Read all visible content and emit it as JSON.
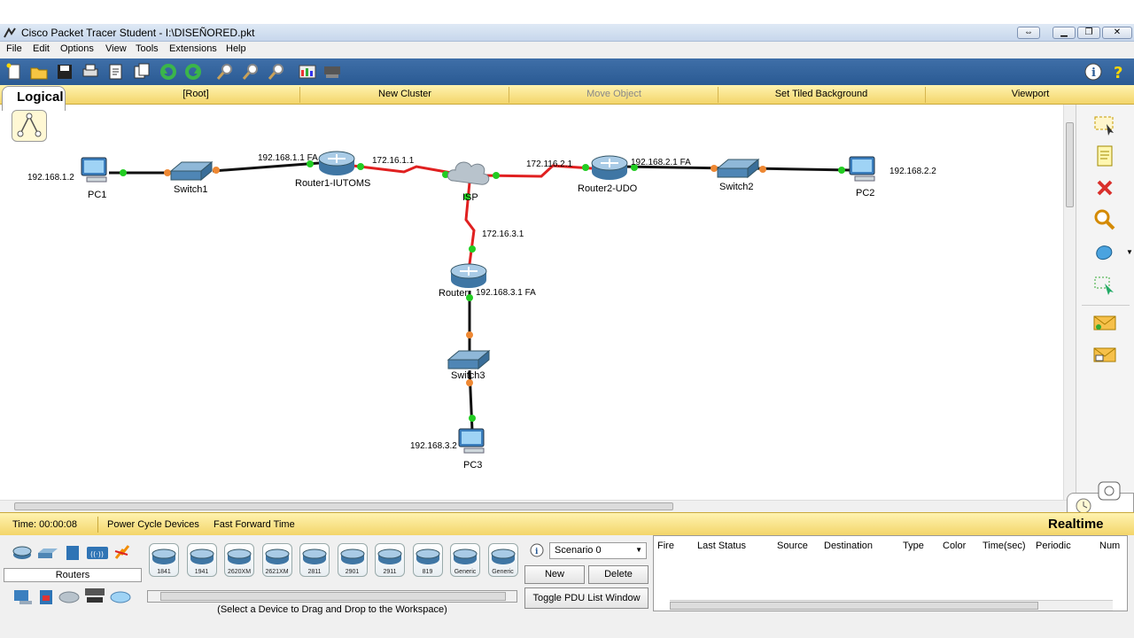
{
  "window": {
    "title": "Cisco Packet Tracer Student - I:\\DISEÑORED.pkt"
  },
  "menu": [
    "File",
    "Edit",
    "Options",
    "View",
    "Tools",
    "Extensions",
    "Help"
  ],
  "toolbar_icons": [
    "new-icon",
    "open-icon",
    "save-icon",
    "print-icon",
    "activity-wizard-icon",
    "copy-icon",
    "undo-icon",
    "redo-icon",
    "zoom-in-icon",
    "zoom-reset-icon",
    "zoom-out-icon",
    "palette-icon",
    "custom-device-icon",
    "info-icon",
    "help-icon"
  ],
  "logical_bar": {
    "tab": "Logical",
    "root": "[Root]",
    "new_cluster": "New Cluster",
    "move_object": "Move Object",
    "set_tiled_background": "Set Tiled Background",
    "viewport": "Viewport"
  },
  "topology": {
    "devices": [
      {
        "id": "pc1",
        "type": "pc",
        "name": "PC1",
        "ip": "192.168.1.2"
      },
      {
        "id": "switch1",
        "type": "switch",
        "name": "Switch1"
      },
      {
        "id": "router1",
        "type": "router",
        "name": "Router1-IUTOMS",
        "ip": "192.168.1.1 FA"
      },
      {
        "id": "isp",
        "type": "cloud",
        "name": "ISP"
      },
      {
        "id": "router2",
        "type": "router",
        "name": "Router2-UDO",
        "ip": "192.168.2.1 FA"
      },
      {
        "id": "switch2",
        "type": "switch",
        "name": "Switch2"
      },
      {
        "id": "pc2",
        "type": "pc",
        "name": "PC2",
        "ip": "192.168.2.2"
      },
      {
        "id": "router3",
        "type": "router",
        "name": "Router",
        "ip": "192.168.3.1 FA"
      },
      {
        "id": "switch3",
        "type": "switch",
        "name": "Switch3"
      },
      {
        "id": "pc3",
        "type": "pc",
        "name": "PC3",
        "ip": "192.168.3.2"
      }
    ],
    "link_labels": {
      "r1_isp": "172.16.1.1",
      "r2_isp": "172.116.2.1",
      "r3_isp": "172.16.3.1"
    }
  },
  "status": {
    "time": "Time: 00:00:08",
    "power_cycle": "Power Cycle Devices",
    "fast_forward": "Fast Forward Time",
    "mode": "Realtime"
  },
  "device_panel": {
    "category_label": "Routers",
    "models": [
      "1841",
      "1941",
      "2620XM",
      "2621XM",
      "2811",
      "2901",
      "2911",
      "819",
      "Generic",
      "Generic"
    ],
    "hint": "(Select a Device to Drag and Drop to the Workspace)"
  },
  "scenario": {
    "selected": "Scenario 0",
    "new_label": "New",
    "delete_label": "Delete",
    "toggle_label": "Toggle PDU List Window"
  },
  "pdu_table": {
    "columns": [
      "Fire",
      "Last Status",
      "Source",
      "Destination",
      "Type",
      "Color",
      "Time(sec)",
      "Periodic",
      "Num"
    ]
  },
  "colors": {
    "link_serial": "#e02020",
    "link_ethernet": "#111111",
    "port_up": "#22cc22",
    "port_wait": "#ee8833"
  }
}
